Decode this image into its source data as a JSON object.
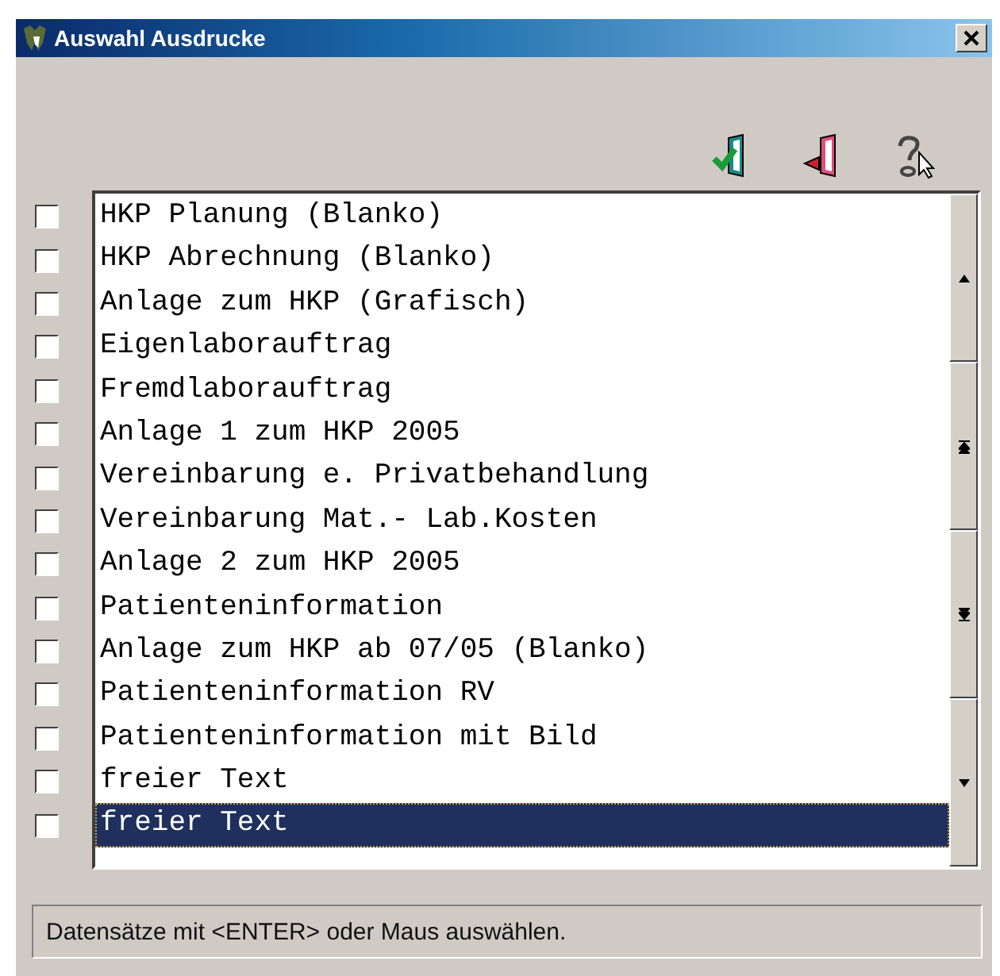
{
  "window": {
    "title": "Auswahl Ausdrucke"
  },
  "items": [
    {
      "label": "HKP Planung (Blanko)",
      "checked": false,
      "selected": false
    },
    {
      "label": "HKP Abrechnung (Blanko)",
      "checked": false,
      "selected": false
    },
    {
      "label": "Anlage zum HKP (Grafisch)",
      "checked": false,
      "selected": false
    },
    {
      "label": "Eigenlaborauftrag",
      "checked": false,
      "selected": false
    },
    {
      "label": "Fremdlaborauftrag",
      "checked": false,
      "selected": false
    },
    {
      "label": "Anlage 1 zum HKP 2005",
      "checked": false,
      "selected": false
    },
    {
      "label": "Vereinbarung e. Privatbehandlung",
      "checked": false,
      "selected": false
    },
    {
      "label": "Vereinbarung Mat.- Lab.Kosten",
      "checked": false,
      "selected": false
    },
    {
      "label": "Anlage 2 zum HKP 2005",
      "checked": false,
      "selected": false
    },
    {
      "label": "Patienteninformation",
      "checked": false,
      "selected": false
    },
    {
      "label": "Anlage zum HKP ab 07/05 (Blanko)",
      "checked": false,
      "selected": false
    },
    {
      "label": "Patienteninformation RV",
      "checked": false,
      "selected": false
    },
    {
      "label": "Patienteninformation mit Bild",
      "checked": false,
      "selected": false
    },
    {
      "label": "freier Text",
      "checked": false,
      "selected": false
    },
    {
      "label": "freier Text",
      "checked": false,
      "selected": true
    }
  ],
  "status_bar": "Datensätze mit <ENTER> oder Maus auswählen."
}
